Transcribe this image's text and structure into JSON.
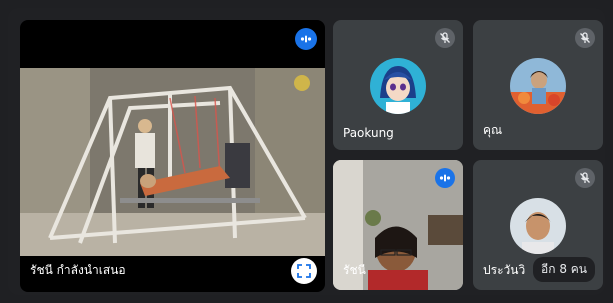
{
  "main": {
    "caption": "รัชนี กำลังนำเสนอ"
  },
  "participants": [
    {
      "name": "Paokung",
      "muted": true
    },
    {
      "name": "คุณ",
      "muted": true
    },
    {
      "name": "รัชนี",
      "speaking": true
    },
    {
      "name": "ประวันวิ",
      "muted": true
    }
  ],
  "more": "อีก 8 คน",
  "colors": {
    "accent": "#1a73e8",
    "tile": "#3c4043",
    "bg": "#202124"
  }
}
